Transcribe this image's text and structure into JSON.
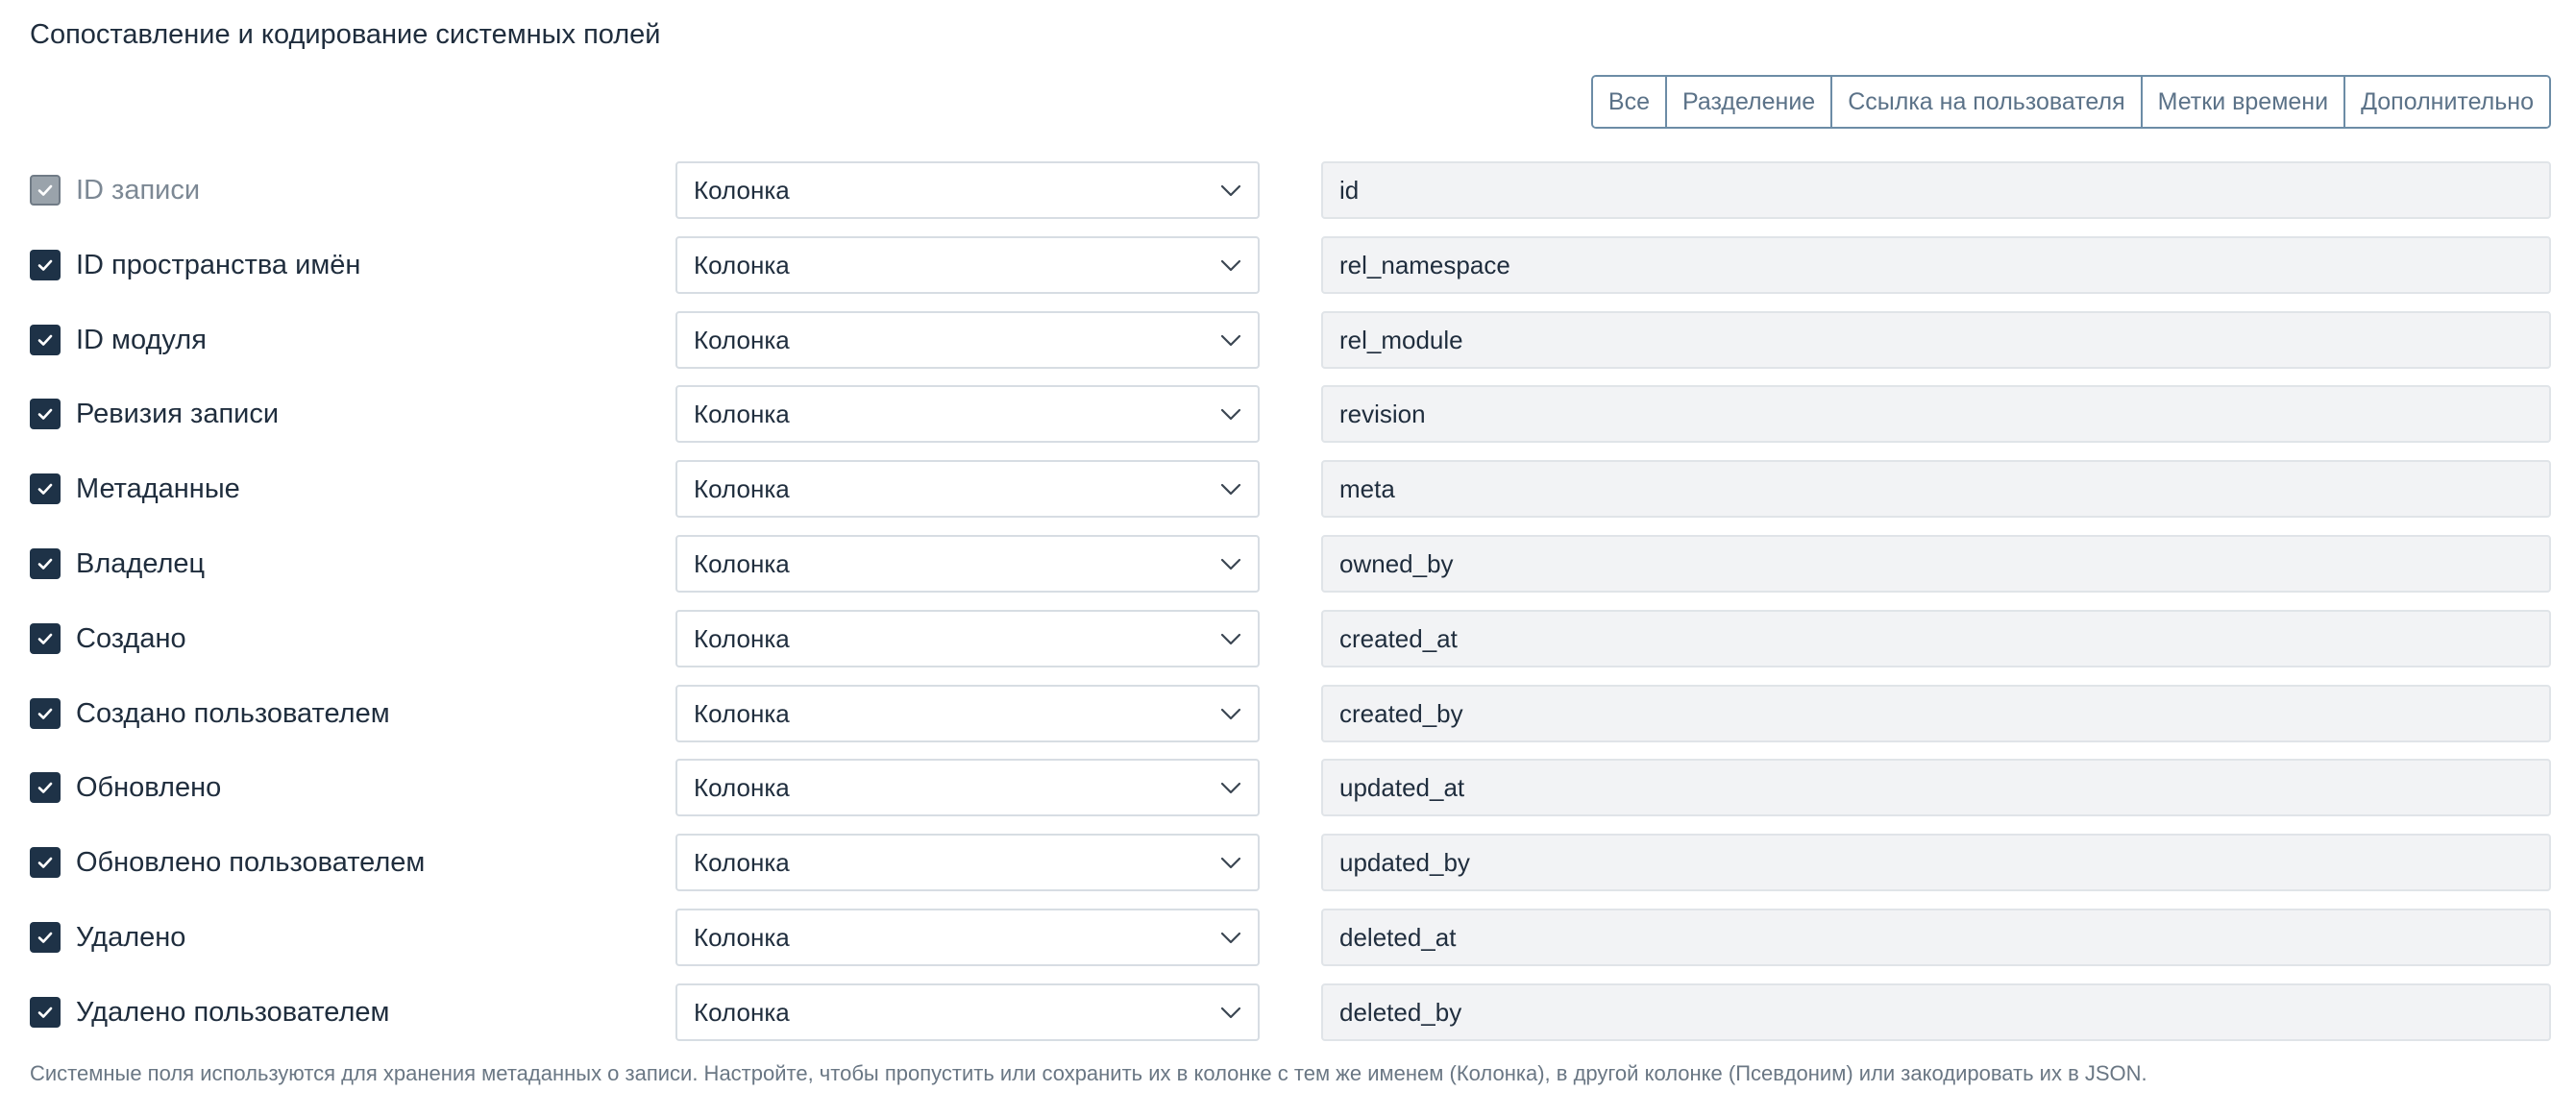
{
  "section": {
    "title": "Сопоставление и кодирование системных полей",
    "help_text": "Системные поля используются для хранения метаданных о записи. Настройте, чтобы пропустить или сохранить их в колонке с тем же именем (Колонка), в другой колонке (Псевдоним) или закодировать их в JSON."
  },
  "filters": [
    {
      "label": "Все"
    },
    {
      "label": "Разделение"
    },
    {
      "label": "Ссылка на пользователя"
    },
    {
      "label": "Метки времени"
    },
    {
      "label": "Дополнительно"
    }
  ],
  "fields": [
    {
      "label": "ID записи",
      "checked": true,
      "disabled": true,
      "encoding": "Колонка",
      "column": "id"
    },
    {
      "label": "ID пространства имён",
      "checked": true,
      "disabled": false,
      "encoding": "Колонка",
      "column": "rel_namespace"
    },
    {
      "label": "ID модуля",
      "checked": true,
      "disabled": false,
      "encoding": "Колонка",
      "column": "rel_module"
    },
    {
      "label": "Ревизия записи",
      "checked": true,
      "disabled": false,
      "encoding": "Колонка",
      "column": "revision"
    },
    {
      "label": "Метаданные",
      "checked": true,
      "disabled": false,
      "encoding": "Колонка",
      "column": "meta"
    },
    {
      "label": "Владелец",
      "checked": true,
      "disabled": false,
      "encoding": "Колонка",
      "column": "owned_by"
    },
    {
      "label": "Создано",
      "checked": true,
      "disabled": false,
      "encoding": "Колонка",
      "column": "created_at"
    },
    {
      "label": "Создано пользователем",
      "checked": true,
      "disabled": false,
      "encoding": "Колонка",
      "column": "created_by"
    },
    {
      "label": "Обновлено",
      "checked": true,
      "disabled": false,
      "encoding": "Колонка",
      "column": "updated_at"
    },
    {
      "label": "Обновлено пользователем",
      "checked": true,
      "disabled": false,
      "encoding": "Колонка",
      "column": "updated_by"
    },
    {
      "label": "Удалено",
      "checked": true,
      "disabled": false,
      "encoding": "Колонка",
      "column": "deleted_at"
    },
    {
      "label": "Удалено пользователем",
      "checked": true,
      "disabled": false,
      "encoding": "Колонка",
      "column": "deleted_by"
    }
  ],
  "icons": {
    "checkbox": "check-icon",
    "select": "chevron-down-icon"
  },
  "colors": {
    "checkbox_fill": "#1e3247",
    "checkbox_disabled": "#9aa3ab",
    "filter_border": "#6c8ca6",
    "input_readonly_bg": "#f2f3f5"
  }
}
